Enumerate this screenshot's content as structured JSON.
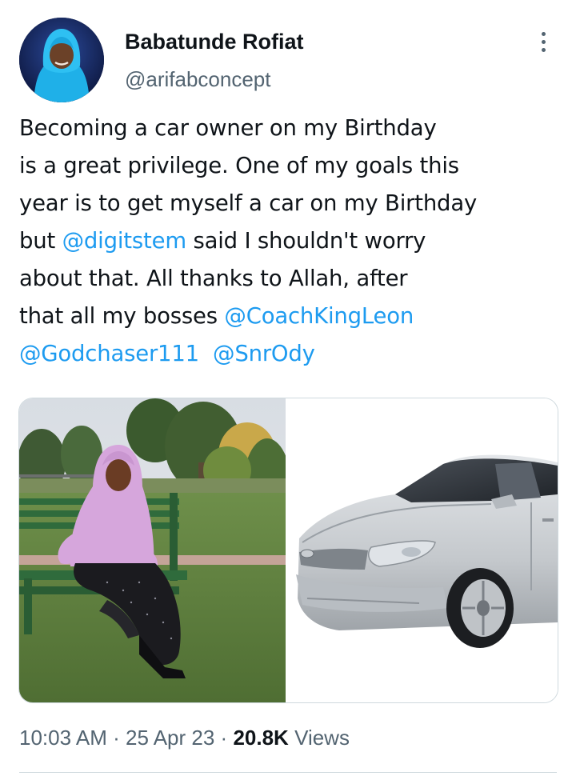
{
  "tweet": {
    "author": {
      "display_name": "Babatunde Rofiat",
      "handle": "@arifabconcept"
    },
    "text": {
      "line1": "Becoming a car owner on my Birthday",
      "line2": "is a great privilege. One of my goals this",
      "line3": "year is to get myself a car on my Birthday",
      "line4_pre": "but ",
      "line4_mention": "@digitstem",
      "line4_post": " said I shouldn't worry",
      "line5": "about that. All thanks to Allah, after",
      "line6_pre": "that all my bosses ",
      "line6_mention": "@CoachKingLeon",
      "line7_mention_1": "@Godchaser111",
      "line7_mention_2": "@SnrOdy"
    },
    "media": [
      {
        "icon": "photo-woman-on-bench"
      },
      {
        "icon": "photo-silver-car"
      }
    ],
    "meta": {
      "time": "10:03 AM",
      "separator": "·",
      "date": "25 Apr 23",
      "views_count": "20.8K",
      "views_label": "Views"
    }
  },
  "colors": {
    "accent": "#1d9bf0",
    "text": "#0f1419",
    "secondary": "#536471",
    "border": "#cfd9de"
  },
  "icons": {
    "more": "more-vertical-icon"
  }
}
